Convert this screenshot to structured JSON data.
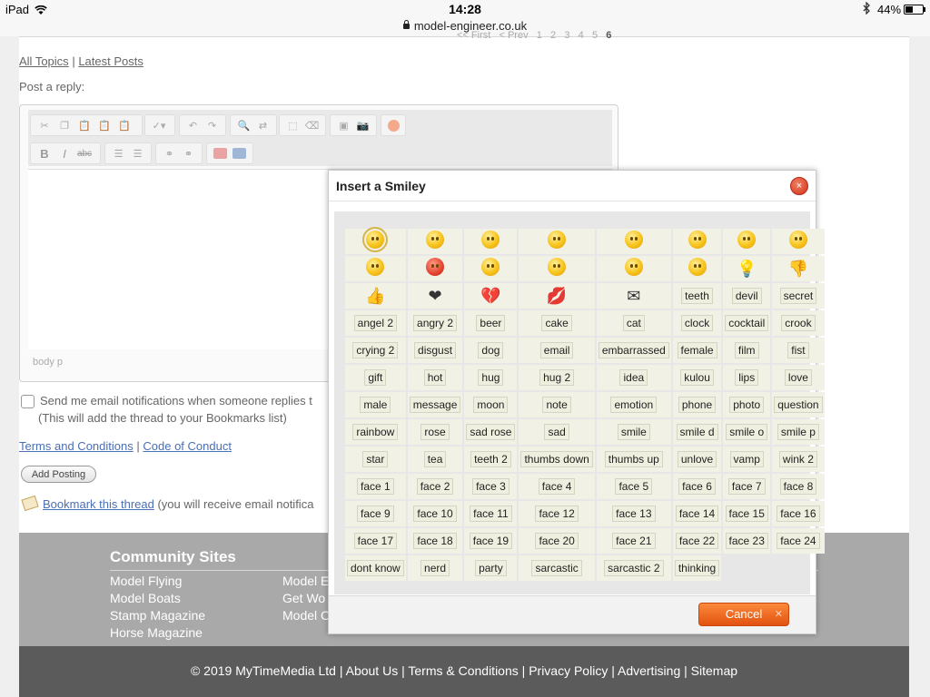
{
  "status_bar": {
    "device": "iPad",
    "time": "14:28",
    "url": "model-engineer.co.uk",
    "battery": "44%",
    "battery_level": 0.44
  },
  "pager": {
    "first": "<< First",
    "prev": "< Prev",
    "pages": [
      "1",
      "2",
      "3",
      "4",
      "5"
    ],
    "current": "6"
  },
  "topic_links": {
    "all": "All Topics",
    "sep": "|",
    "latest": "Latest Posts"
  },
  "post_label": "Post a reply:",
  "editor": {
    "toolbar_row1": [
      "cut-icon",
      "copy-icon",
      "paste-icon",
      "paste-text-icon",
      "paste-word-icon",
      "spellcheck-icon",
      "undo-icon",
      "redo-icon",
      "find-icon",
      "replace-icon",
      "select-all-icon",
      "remove-format-icon",
      "image-icon",
      "camera-icon",
      "smiley-icon"
    ],
    "toolbar_row2_labels": {
      "bold": "B",
      "italic": "I",
      "strike": "abc"
    },
    "toolbar_row2_icons": [
      "numbered-list-icon",
      "bulleted-list-icon",
      "link-icon",
      "unlink-icon",
      "youtube-icon",
      "source-icon"
    ],
    "path": "body  p"
  },
  "notify": {
    "text": "Send me email notifications when someone replies t",
    "sub": "(This will add the thread to your Bookmarks list)",
    "checked": false
  },
  "legal_links": {
    "terms": "Terms and Conditions",
    "sep": "|",
    "conduct": "Code of Conduct"
  },
  "add_posting": "Add Posting",
  "bookmark": {
    "link": "Bookmark this thread",
    "text": "(you will receive email notifica"
  },
  "community": {
    "heading": "Community Sites",
    "col1": [
      "Model Flying",
      "Model Boats",
      "Stamp Magazine",
      "Horse Magazine"
    ],
    "col2": [
      "Model E",
      "Get Wo",
      "Model C"
    ]
  },
  "footer": {
    "links": [
      "© 2019 MyTimeMedia Ltd",
      "About Us",
      "Terms & Conditions",
      "Privacy Policy",
      "Advertising",
      "Sitemap"
    ],
    "sep": "|"
  },
  "smiley_dialog": {
    "title": "Insert a Smiley",
    "icon_rows": [
      [
        "smile-icon",
        "sad-icon",
        "wink-icon",
        "grin-icon",
        "tongue-icon",
        "tongue-out-icon",
        "blush-icon",
        "surprised-icon"
      ],
      [
        "neutral-icon",
        "angry-icon",
        "angel-icon",
        "glasses-icon",
        "devil-face-icon",
        "crying-icon",
        "lightbulb-icon",
        "thumbs-down-icon"
      ]
    ],
    "row3_icons": [
      "thumbs-up-icon",
      "heart-icon",
      "broken-heart-icon",
      "kiss-icon",
      "envelope-icon"
    ],
    "row3_labels": [
      "teeth",
      "devil",
      "secret"
    ],
    "label_rows": [
      [
        "angel 2",
        "angry 2",
        "beer",
        "cake",
        "cat",
        "clock",
        "cocktail",
        "crook"
      ],
      [
        "crying 2",
        "disgust",
        "dog",
        "email",
        "embarrassed",
        "female",
        "film",
        "fist"
      ],
      [
        "gift",
        "hot",
        "hug",
        "hug 2",
        "idea",
        "kulou",
        "lips",
        "love"
      ],
      [
        "male",
        "message",
        "moon",
        "note",
        "emotion",
        "phone",
        "photo",
        "question"
      ],
      [
        "rainbow",
        "rose",
        "sad rose",
        "sad",
        "smile",
        "smile d",
        "smile o",
        "smile p"
      ],
      [
        "star",
        "tea",
        "teeth 2",
        "thumbs down",
        "thumbs up",
        "unlove",
        "vamp",
        "wink 2"
      ],
      [
        "face 1",
        "face 2",
        "face 3",
        "face 4",
        "face 5",
        "face 6",
        "face 7",
        "face 8"
      ],
      [
        "face 9",
        "face 10",
        "face 11",
        "face 12",
        "face 13",
        "face 14",
        "face 15",
        "face 16"
      ],
      [
        "face 17",
        "face 18",
        "face 19",
        "face 20",
        "face 21",
        "face 22",
        "face 23",
        "face 24"
      ],
      [
        "dont know",
        "nerd",
        "party",
        "sarcastic",
        "sarcastic 2",
        "thinking"
      ]
    ],
    "cancel": "Cancel",
    "close_glyph": "×",
    "cancel_glyph": "✕"
  },
  "colors": {
    "accent_orange": "#e2520f",
    "close_red": "#d3311d",
    "link_blue": "#4a6fb5",
    "footer_dark": "#5b5b5b",
    "footer_grey": "#a9a9a9"
  }
}
